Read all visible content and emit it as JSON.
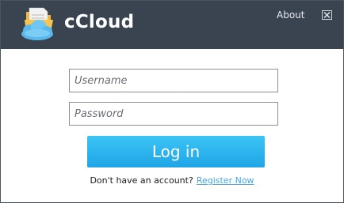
{
  "app": {
    "title": "cCloud",
    "icon": "cloud-folder-icon"
  },
  "header": {
    "about_label": "About",
    "close_icon": "close-icon"
  },
  "form": {
    "username_placeholder": "Username",
    "username_value": "",
    "password_placeholder": "Password",
    "password_value": "",
    "login_label": "Log in"
  },
  "footer": {
    "prompt_text": "Don't have an account?",
    "register_label": "Register Now"
  },
  "colors": {
    "header_bg": "#3a4350",
    "button_bg": "#29b3ee",
    "link": "#4aa3df"
  }
}
